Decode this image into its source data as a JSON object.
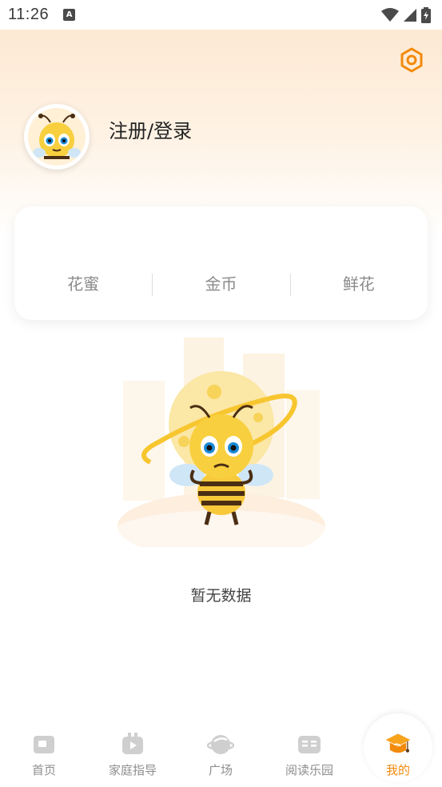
{
  "status_bar": {
    "time": "11:26",
    "notification_letter": "A"
  },
  "profile": {
    "login_label": "注册/登录"
  },
  "stats": [
    {
      "label": "花蜜"
    },
    {
      "label": "金币"
    },
    {
      "label": "鲜花"
    }
  ],
  "empty_state": {
    "message": "暂无数据"
  },
  "tabs": [
    {
      "label": "首页",
      "icon": "home-icon"
    },
    {
      "label": "家庭指导",
      "icon": "video-icon"
    },
    {
      "label": "广场",
      "icon": "planet-icon"
    },
    {
      "label": "阅读乐园",
      "icon": "book-icon"
    },
    {
      "label": "我的",
      "icon": "graduation-cap-icon",
      "active": true
    }
  ],
  "colors": {
    "accent": "#f28a0c",
    "hero_gradient_top": "#fde9d3",
    "inactive_tab": "#c8c8c8"
  }
}
